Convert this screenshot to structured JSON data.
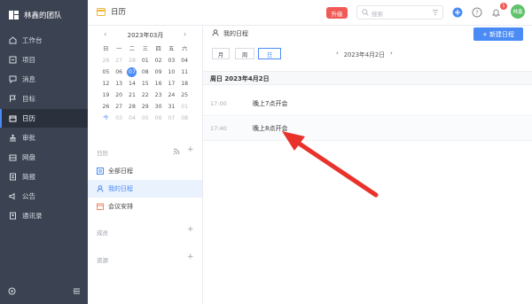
{
  "nav": {
    "team": "林鑫的团队",
    "items": [
      {
        "label": "工作台",
        "icon": "dashboard-icon"
      },
      {
        "label": "项目",
        "icon": "project-icon"
      },
      {
        "label": "消息",
        "icon": "message-icon"
      },
      {
        "label": "目标",
        "icon": "target-icon"
      },
      {
        "label": "日历",
        "icon": "calendar-icon"
      },
      {
        "label": "审批",
        "icon": "approval-icon"
      },
      {
        "label": "网盘",
        "icon": "cloud-drive-icon"
      },
      {
        "label": "简报",
        "icon": "report-icon"
      },
      {
        "label": "公告",
        "icon": "announcement-icon"
      },
      {
        "label": "通讯录",
        "icon": "contacts-icon"
      }
    ],
    "active_index": 4
  },
  "header": {
    "title": "日历",
    "upgrade": "升级",
    "search_placeholder": "搜索",
    "badge_count": "1",
    "avatar_text": "林鑫"
  },
  "mini_calendar": {
    "month": "2023年03月",
    "weekdays": [
      "日",
      "一",
      "二",
      "三",
      "四",
      "五",
      "六"
    ],
    "weeks": [
      [
        "26",
        "27",
        "28",
        "01",
        "02",
        "03",
        "04"
      ],
      [
        "05",
        "06",
        "07",
        "08",
        "09",
        "10",
        "11"
      ],
      [
        "12",
        "13",
        "14",
        "15",
        "16",
        "17",
        "18"
      ],
      [
        "19",
        "20",
        "21",
        "22",
        "23",
        "24",
        "25"
      ],
      [
        "26",
        "27",
        "28",
        "29",
        "30",
        "31",
        "01"
      ],
      [
        "今",
        "03",
        "04",
        "05",
        "06",
        "07",
        "08"
      ]
    ]
  },
  "calendars": {
    "label": "日历",
    "items": [
      {
        "label": "全部日程"
      },
      {
        "label": "我的日程"
      },
      {
        "label": "会议安排"
      }
    ],
    "members_label": "成员",
    "resources_label": "资源"
  },
  "main": {
    "title": "我的日程",
    "new_button": "+ 新建日程",
    "views": [
      "月",
      "周",
      "日"
    ],
    "active_view": "日",
    "date": "2023年4月2日",
    "day_header": "周日 2023年4月2日",
    "events": [
      {
        "time": "17:00",
        "title": "晚上7点开会"
      },
      {
        "time": "17:40",
        "title": "晚上8点开会"
      }
    ]
  }
}
